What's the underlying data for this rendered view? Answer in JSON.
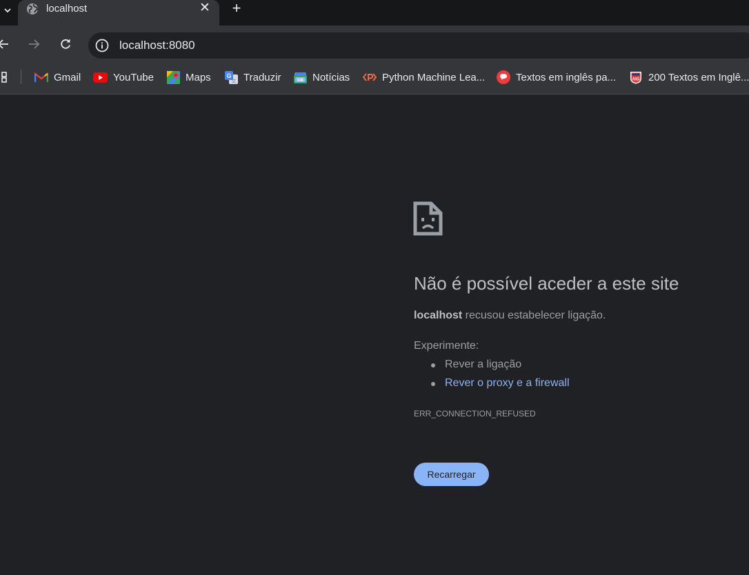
{
  "tab": {
    "title": "localhost",
    "close_glyph": "✕",
    "new_tab_glyph": "+"
  },
  "toolbar": {
    "url": "localhost:8080"
  },
  "bookmarks": [
    {
      "label": "Gmail",
      "icon": "gmail-icon"
    },
    {
      "label": "YouTube",
      "icon": "youtube-icon"
    },
    {
      "label": "Maps",
      "icon": "maps-icon"
    },
    {
      "label": "Traduzir",
      "icon": "translate-icon"
    },
    {
      "label": "Notícias",
      "icon": "news-icon"
    },
    {
      "label": "Python Machine Lea...",
      "icon": "python-ml-icon"
    },
    {
      "label": "Textos em inglês pa...",
      "icon": "chat-bubble-icon"
    },
    {
      "label": "200 Textos em Inglê...",
      "icon": "aig-icon"
    }
  ],
  "error": {
    "title": "Não é possível aceder a este site",
    "host": "localhost",
    "description": " recusou estabelecer ligação.",
    "try_label": "Experimente:",
    "suggestions": [
      "Rever a ligação",
      "Rever o proxy e a firewall"
    ],
    "code": "ERR_CONNECTION_REFUSED",
    "reload_label": "Recarregar"
  },
  "colors": {
    "page_background": "#202124",
    "chrome_toolbar": "#35363a",
    "link": "#8ab4f8",
    "button": "#8ab4f8"
  }
}
